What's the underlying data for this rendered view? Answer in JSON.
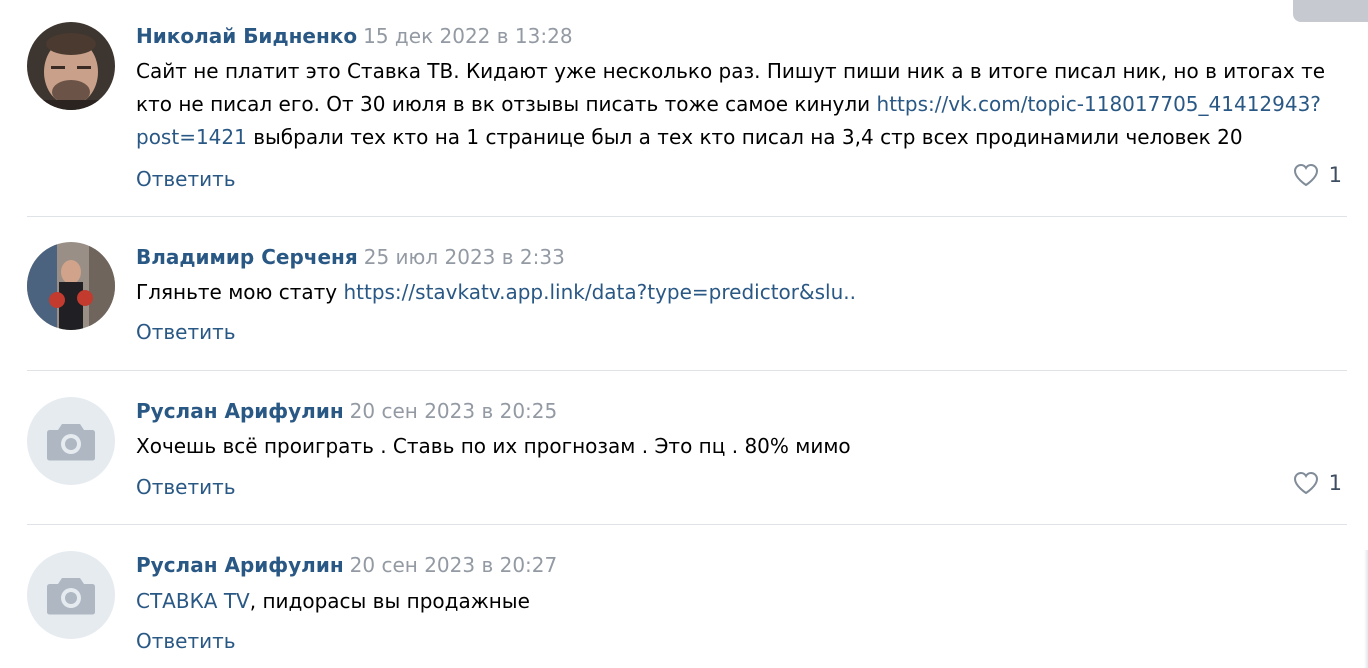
{
  "comments": [
    {
      "author": "Николай Бидненко",
      "date": "15 дек 2022 в 13:28",
      "text_parts": [
        "Сайт не платит это Ставка ТВ. Кидают уже несколько раз. Пишут пиши ник а в итоге писал ник, но в итогах те кто не писал его. От 30 июля в вк отзывы писать тоже самое кинули ",
        "https://vk.com/topic-118017705_41412943?post=1421",
        " выбрали тех кто на 1 странице был а тех кто писал на 3,4 стр всех продинамили человек 20"
      ],
      "reply_label": "Ответить",
      "likes": "1"
    },
    {
      "author": "Владимир Серченя",
      "date": "25 июл 2023 в 2:33",
      "text_parts": [
        "Гляньте мою стату ",
        "https://stavkatv.app.link/data?type=predictor&slu.."
      ],
      "reply_label": "Ответить"
    },
    {
      "author": "Руслан Арифулин",
      "date": "20 сен 2023 в 20:25",
      "text": "Хочешь всё проиграть . Ставь по их прогнозам . Это пц . 80% мимо",
      "reply_label": "Ответить",
      "likes": "1"
    },
    {
      "author": "Руслан Арифулин",
      "date": "20 сен 2023 в 20:27",
      "text_parts": [
        "СТАВКА TV",
        ", пидорасы вы продажные"
      ],
      "reply_label": "Ответить"
    }
  ],
  "icons": {
    "like": "heart-outline-icon",
    "placeholder_avatar": "camera-icon"
  },
  "colors": {
    "link": "#2a5885",
    "date": "#939aa3",
    "placeholder_avatar_bg": "#e6ebf0",
    "divider": "#dfe3e8"
  }
}
